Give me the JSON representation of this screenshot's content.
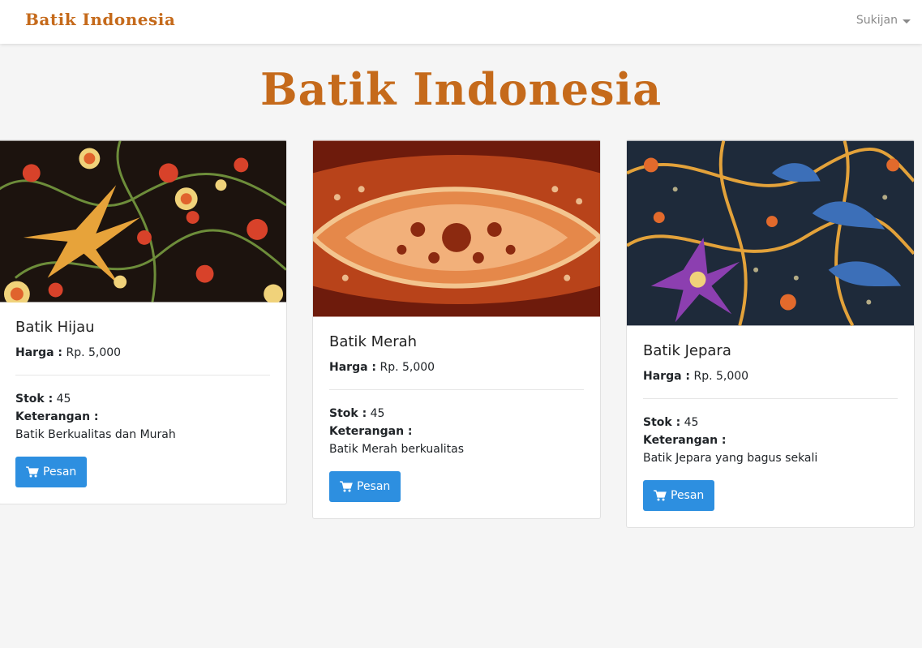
{
  "navbar": {
    "brand": "Batik Indonesia",
    "user": "Sukijan"
  },
  "page": {
    "title": "Batik Indonesia"
  },
  "products": [
    {
      "name": "Batik Hijau",
      "price_label": "Harga :",
      "price": "Rp. 5,000",
      "stock_label": "Stok :",
      "stock": "45",
      "desc_label": "Keterangan :",
      "description": "Batik Berkualitas dan Murah",
      "button": "Pesan"
    },
    {
      "name": "Batik Merah",
      "price_label": "Harga :",
      "price": "Rp. 5,000",
      "stock_label": "Stok :",
      "stock": "45",
      "desc_label": "Keterangan :",
      "description": "Batik Merah berkualitas",
      "button": "Pesan"
    },
    {
      "name": "Batik Jepara",
      "price_label": "Harga :",
      "price": "Rp. 5,000",
      "stock_label": "Stok :",
      "stock": "45",
      "desc_label": "Keterangan :",
      "description": "Batik Jepara yang bagus sekali",
      "button": "Pesan"
    }
  ],
  "colors": {
    "brand": "#c56a1b",
    "button": "#2d8fe0",
    "background": "#f5f5f5"
  },
  "icons": {
    "cart": "shopping-cart-icon",
    "dropdown": "caret-down-icon"
  }
}
